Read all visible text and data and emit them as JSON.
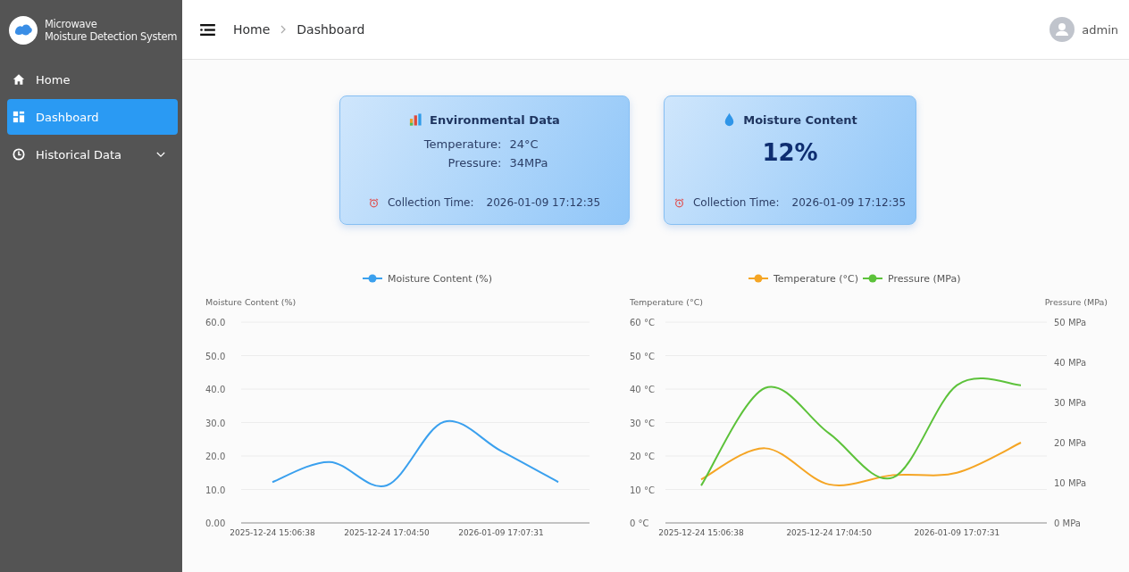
{
  "sidebar": {
    "title_lines": [
      "Microwave",
      "Moisture Detection System"
    ],
    "items": [
      {
        "label": "Home",
        "selected": false,
        "expandable": false
      },
      {
        "label": "Dashboard",
        "selected": true,
        "expandable": false
      },
      {
        "label": "Historical Data",
        "selected": false,
        "expandable": true
      }
    ]
  },
  "header": {
    "breadcrumb": [
      "Home",
      "Dashboard"
    ],
    "user": "admin"
  },
  "cards": [
    {
      "kind": "environment",
      "title": "Environmental Data",
      "rows": [
        {
          "label": "Temperature:",
          "value": "24°C"
        },
        {
          "label": "Pressure:",
          "value": "34MPa"
        }
      ],
      "time_label": "Collection Time:",
      "time": "2026-01-09 17:12:35"
    },
    {
      "kind": "moisture",
      "title": "Moisture Content",
      "value": "12%",
      "time_label": "Collection Time:",
      "time": "2026-01-09 17:12:35"
    }
  ],
  "charts": [
    {
      "chart_data": {
        "type": "line",
        "ylabel": "Moisture Content (%)",
        "categories": [
          "2025-12-24 15:06:38",
          null,
          "2025-12-24 17:04:50",
          null,
          "2026-01-09 17:07:31",
          null
        ],
        "grid": true,
        "legend": "top",
        "series": [
          {
            "name": "Moisture Content (%)",
            "color": "#3aa0ee",
            "values": [
              12.2,
              18.2,
              11.2,
              30.2,
              21.5,
              12.2
            ]
          }
        ],
        "ylim": [
          0,
          60
        ],
        "yticks": [
          {
            "value": 0,
            "label": "0.00"
          },
          {
            "value": 10,
            "label": "10.0"
          },
          {
            "value": 20,
            "label": "20.0"
          },
          {
            "value": 30,
            "label": "30.0"
          },
          {
            "value": 40,
            "label": "40.0"
          },
          {
            "value": 50,
            "label": "50.0"
          },
          {
            "value": 60,
            "label": "60.0"
          }
        ]
      }
    },
    {
      "chart_data": {
        "type": "line",
        "ylabel": "Temperature (°C)",
        "y2label": "Pressure (MPa)",
        "categories": [
          "2025-12-24 15:06:38",
          null,
          "2025-12-24 17:04:50",
          null,
          "2026-01-09 17:07:31",
          null
        ],
        "grid": true,
        "legend": "top",
        "series": [
          {
            "name": "Temperature (°C)",
            "color": "#f5a524",
            "values": [
              13,
              22.3,
              11.5,
              14.3,
              15,
              24
            ]
          },
          {
            "name": "Pressure (MPa)",
            "color": "#5cc23a",
            "axis": "y2",
            "values": [
              9.3,
              33.6,
              22.3,
              11.3,
              34.3,
              34.3
            ]
          }
        ],
        "ylim": [
          0,
          60
        ],
        "y2lim": [
          0,
          50
        ],
        "yticks": [
          {
            "value": 0,
            "label": "0 °C"
          },
          {
            "value": 10,
            "label": "10 °C"
          },
          {
            "value": 20,
            "label": "20 °C"
          },
          {
            "value": 30,
            "label": "30 °C"
          },
          {
            "value": 40,
            "label": "40 °C"
          },
          {
            "value": 50,
            "label": "50 °C"
          },
          {
            "value": 60,
            "label": "60 °C"
          }
        ],
        "y2ticks": [
          {
            "value": 0,
            "label": "0 MPa"
          },
          {
            "value": 10,
            "label": "10 MPa"
          },
          {
            "value": 20,
            "label": "20 MPa"
          },
          {
            "value": 30,
            "label": "30 MPa"
          },
          {
            "value": 40,
            "label": "40 MPa"
          },
          {
            "value": 50,
            "label": "50 MPa"
          }
        ]
      }
    }
  ]
}
